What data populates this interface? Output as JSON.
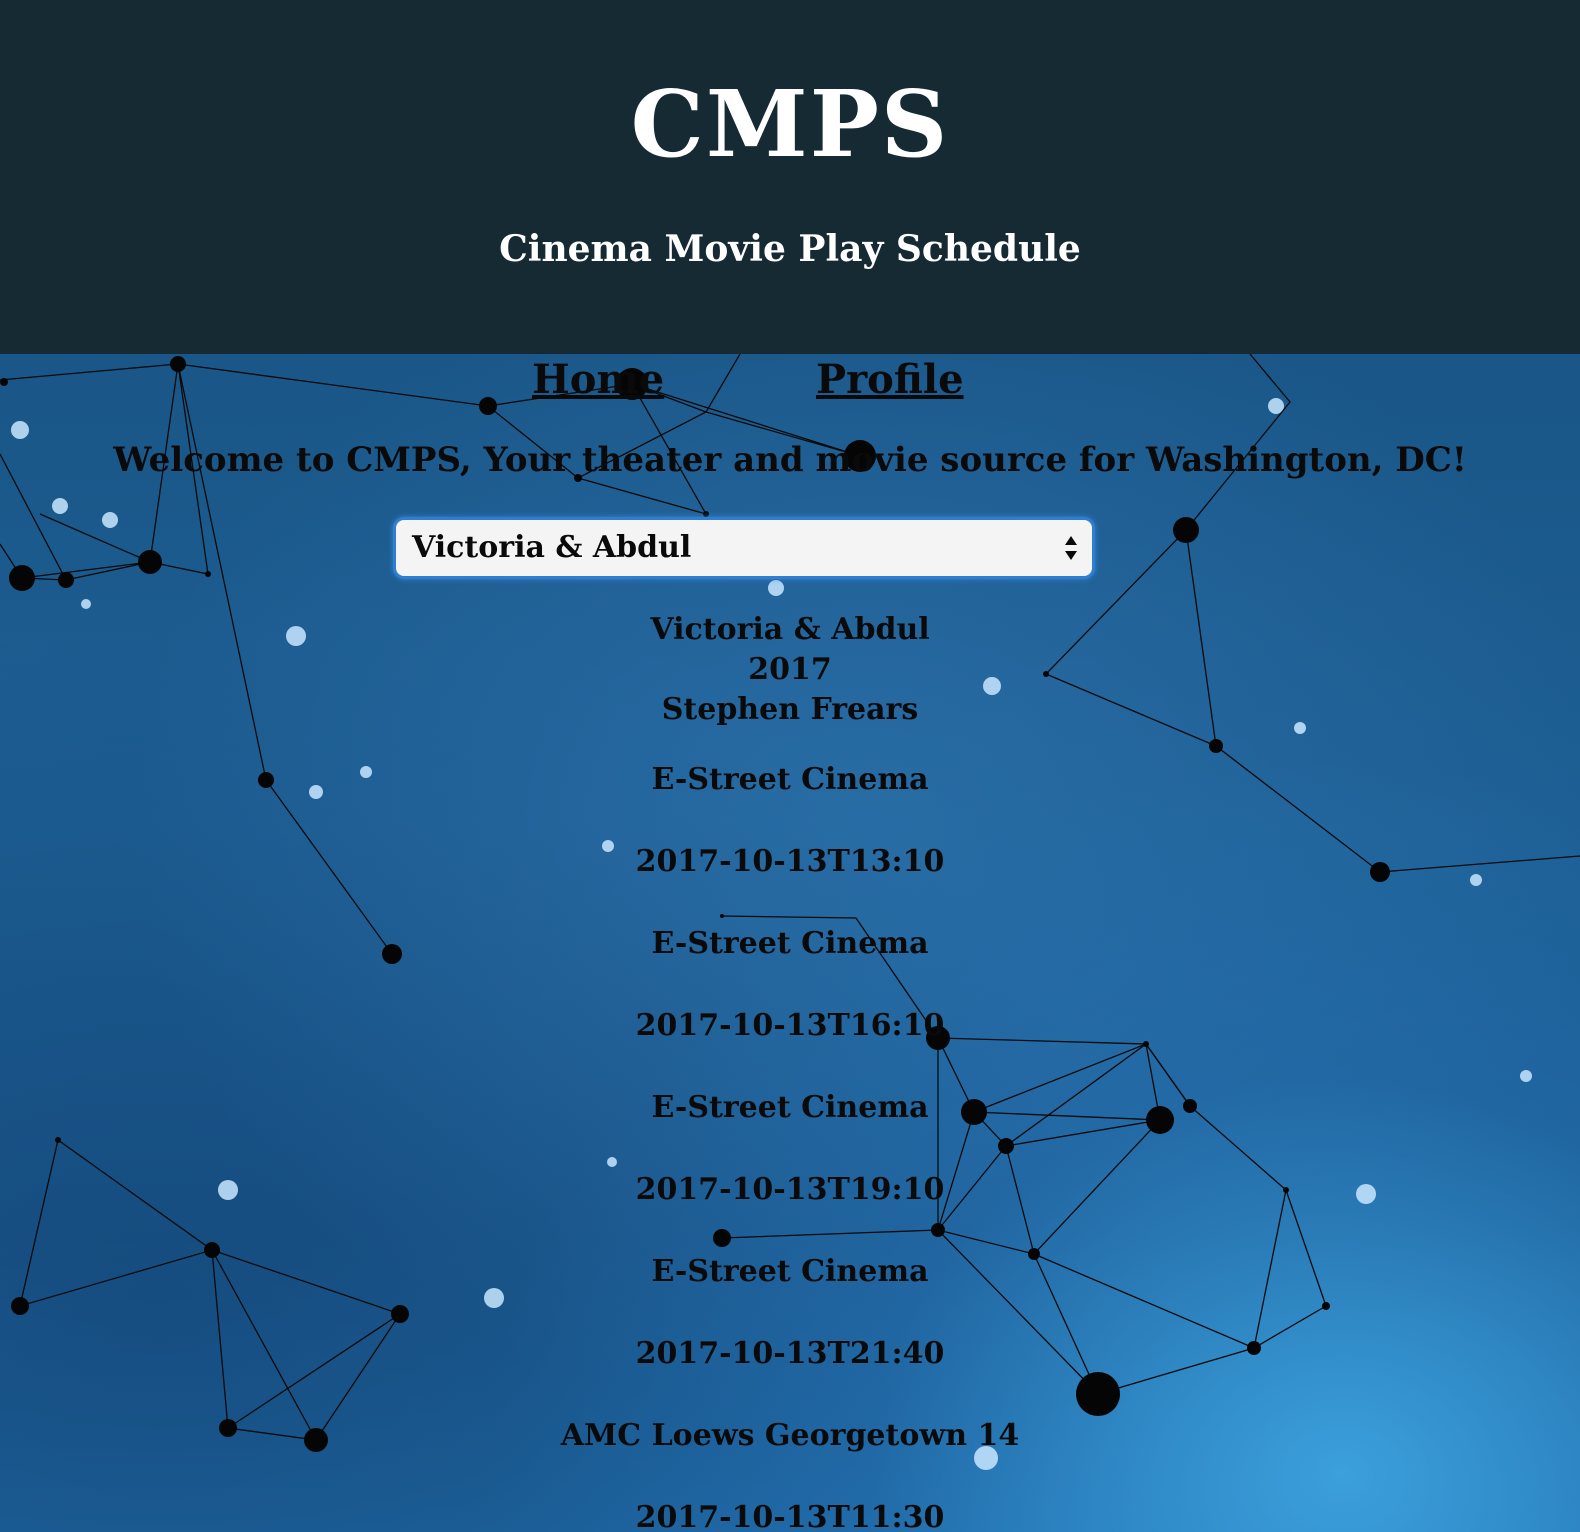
{
  "header": {
    "logo": "CMPS",
    "subtitle": "Cinema Movie Play Schedule"
  },
  "nav": {
    "home": "Home",
    "profile": "Profile"
  },
  "welcome": "Welcome to CMPS, Your theater and movie source for Washington, DC!",
  "movie_select": {
    "selected": "Victoria & Abdul"
  },
  "movie": {
    "title": "Victoria & Abdul",
    "year": "2017",
    "director": "Stephen Frears"
  },
  "showings": [
    {
      "theater": "E-Street Cinema",
      "time": "2017-10-13T13:10"
    },
    {
      "theater": "E-Street Cinema",
      "time": "2017-10-13T16:10"
    },
    {
      "theater": "E-Street Cinema",
      "time": "2017-10-13T19:10"
    },
    {
      "theater": "E-Street Cinema",
      "time": "2017-10-13T21:40"
    },
    {
      "theater": "AMC Loews Georgetown 14",
      "time": "2017-10-13T11:30"
    }
  ],
  "colors": {
    "header_bg": "#162a33",
    "header_text": "#ffffff",
    "body_text": "#0a0a0a",
    "select_focus": "#2f7fd0"
  }
}
